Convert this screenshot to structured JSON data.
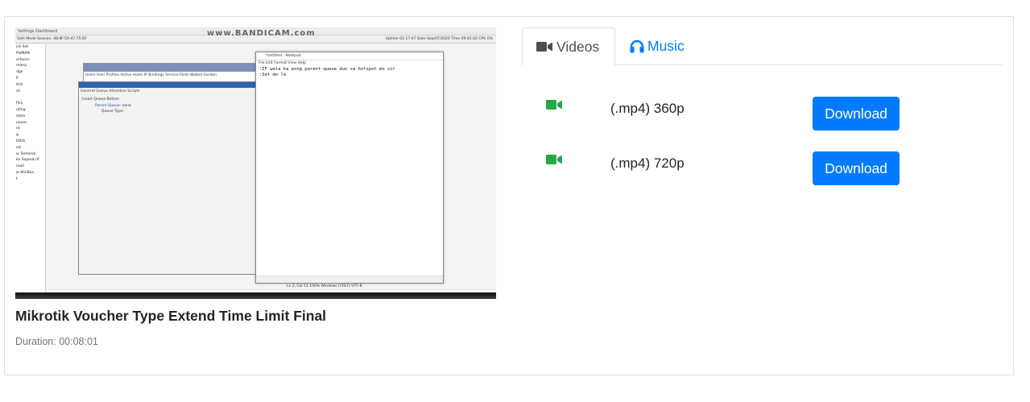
{
  "video": {
    "title": "Mikrotik Voucher Type Extend Time Limit Final",
    "duration": "Duration: 00:08:01",
    "thumbnail": {
      "watermark": "www.BANDICAM.com",
      "menu_text": "Settings   Dashboard",
      "toolbar_text": "Safe Mode   Session: 48:8F:5A:47:75:DF",
      "status_text": "Uptime 01:17:47  Date Sep/07/2020  Time 09:42:42  CPU 0%",
      "sidebar": [
        "ick Set",
        "PwMAN",
        "erfaces",
        "reless",
        "dge",
        "P",
        "itch",
        "sh",
        "",
        "PLS",
        "uting",
        "stem",
        "ueues",
        "es",
        "g",
        "DIUS",
        "ols",
        "w Terminal",
        "ke Supout.rif",
        "nual",
        "w WinBox",
        "t"
      ],
      "hotspot_tabs": "Users  User Profiles  Active  Hosts  IP Bindings  Service Ports  Walled Garden",
      "profile_title": "Hotspot User Profile <3minutes>",
      "profile_tabs": "General  Queue  Advertise  Scripts",
      "field1": "Insert Queue Before:",
      "field2": "Parent Queue:",
      "field2_value": "none",
      "field3": "Queue Type:",
      "notepad_title": "*Untitled - Notepad",
      "notepad_menu": "File  Edit  Format  View  Help",
      "notepad_text": ":IF wala ka pong parent-queue dun sa hotspot mo sir\n:Set mo la",
      "notepad_status": "Ln 2, Col 11     100%   Windows (CRLF)   UTF-8"
    }
  },
  "tabs": {
    "videos_label": "Videos",
    "music_label": "Music"
  },
  "formats": [
    {
      "label": "(.mp4) 360p",
      "button": "Download"
    },
    {
      "label": "(.mp4) 720p",
      "button": "Download"
    }
  ],
  "colors": {
    "primary": "#007bff",
    "video_icon_green": "#28a745",
    "muted": "#6c757d"
  }
}
